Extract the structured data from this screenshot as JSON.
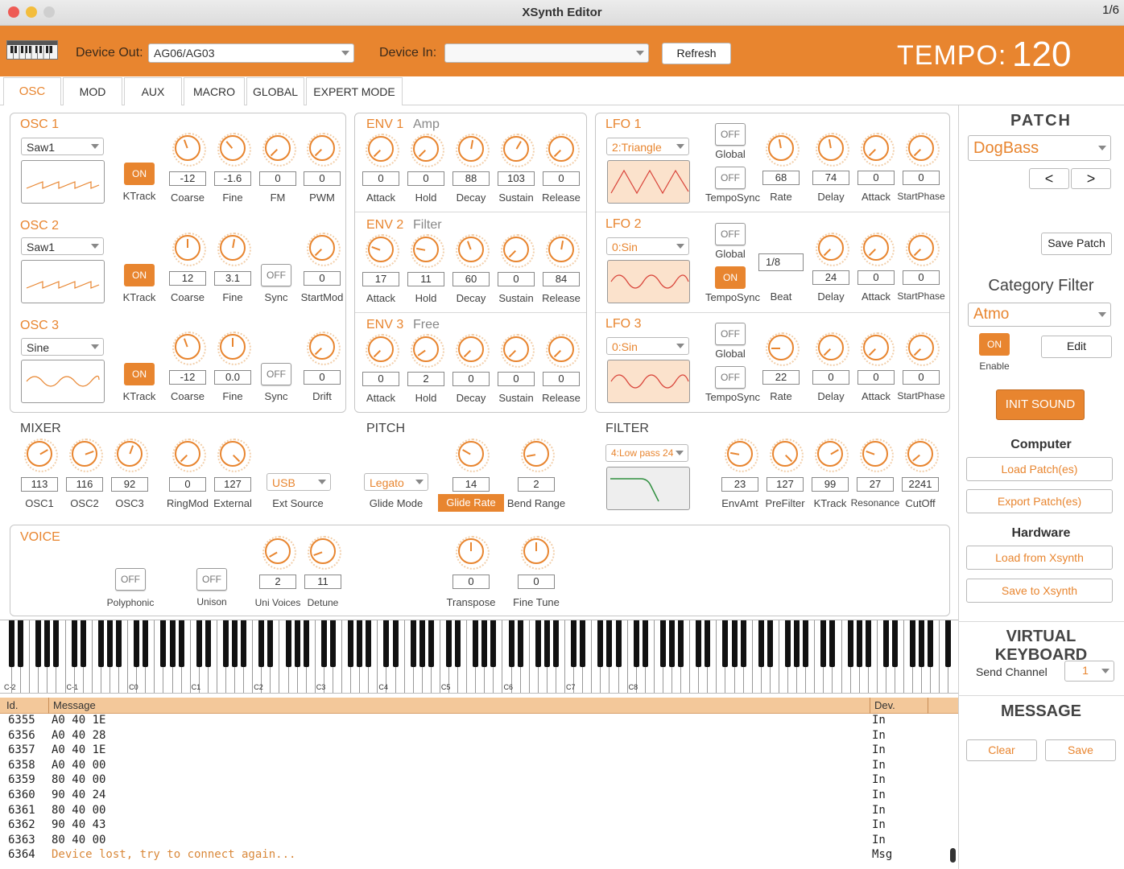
{
  "window": {
    "title": "XSynth Editor",
    "page_indicator": "1/6"
  },
  "topbar": {
    "device_out_label": "Device Out:",
    "device_out_value": "AG06/AG03",
    "device_in_label": "Device In:",
    "device_in_value": "",
    "refresh": "Refresh",
    "tempo_label": "TEMPO:",
    "tempo_value": "120",
    "color": "#e8852f"
  },
  "tabs": [
    "OSC",
    "MOD",
    "AUX",
    "MACRO",
    "GLOBAL",
    "EXPERT MODE"
  ],
  "osc": [
    {
      "title": "OSC 1",
      "wave": "Saw1",
      "ktrack": "ON",
      "ktrack_label": "KTrack",
      "params": [
        {
          "v": "-12",
          "l": "Coarse"
        },
        {
          "v": "-1.6",
          "l": "Fine"
        },
        {
          "v": "0",
          "l": "FM"
        },
        {
          "v": "0",
          "l": "PWM"
        }
      ]
    },
    {
      "title": "OSC 2",
      "wave": "Saw1",
      "ktrack": "ON",
      "ktrack_label": "KTrack",
      "sync": "OFF",
      "sync_label": "Sync",
      "params": [
        {
          "v": "12",
          "l": "Coarse"
        },
        {
          "v": "3.1",
          "l": "Fine"
        },
        {
          "v": "0",
          "l": "StartMod"
        }
      ]
    },
    {
      "title": "OSC 3",
      "wave": "Sine",
      "ktrack": "ON",
      "ktrack_label": "KTrack",
      "sync": "OFF",
      "sync_label": "Sync",
      "params": [
        {
          "v": "-12",
          "l": "Coarse"
        },
        {
          "v": "0.0",
          "l": "Fine"
        },
        {
          "v": "0",
          "l": "Drift"
        }
      ]
    }
  ],
  "env": [
    {
      "title": "ENV 1",
      "sub": "Amp",
      "values": [
        "0",
        "0",
        "88",
        "103",
        "0"
      ]
    },
    {
      "title": "ENV 2",
      "sub": "Filter",
      "values": [
        "17",
        "11",
        "60",
        "0",
        "84"
      ]
    },
    {
      "title": "ENV 3",
      "sub": "Free",
      "values": [
        "0",
        "2",
        "0",
        "0",
        "0"
      ]
    }
  ],
  "env_labels": [
    "Attack",
    "Hold",
    "Decay",
    "Sustain",
    "Release"
  ],
  "lfo": [
    {
      "title": "LFO 1",
      "wave": "2:Triangle",
      "global": "OFF",
      "global_label": "Global",
      "tsync": "OFF",
      "tsync_label": "TempoSync",
      "values": [
        "68",
        "74",
        "0",
        "0"
      ],
      "labels": [
        "Rate",
        "Delay",
        "Attack",
        "StartPhase"
      ]
    },
    {
      "title": "LFO 2",
      "wave": "0:Sin",
      "global": "OFF",
      "global_label": "Global",
      "tsync": "ON",
      "tsync_label": "TempoSync",
      "values": [
        "1/8",
        "24",
        "0",
        "0"
      ],
      "labels": [
        "Beat",
        "Delay",
        "Attack",
        "StartPhase"
      ]
    },
    {
      "title": "LFO 3",
      "wave": "0:Sin",
      "global": "OFF",
      "global_label": "Global",
      "tsync": "OFF",
      "tsync_label": "TempoSync",
      "values": [
        "22",
        "0",
        "0",
        "0"
      ],
      "labels": [
        "Rate",
        "Delay",
        "Attack",
        "StartPhase"
      ]
    }
  ],
  "mixer": {
    "title": "MIXER",
    "params": [
      {
        "v": "113",
        "l": "OSC1"
      },
      {
        "v": "116",
        "l": "OSC2"
      },
      {
        "v": "92",
        "l": "OSC3"
      },
      {
        "v": "0",
        "l": "RingMod"
      },
      {
        "v": "127",
        "l": "External"
      }
    ],
    "ext_source": "USB",
    "ext_source_label": "Ext Source"
  },
  "pitch": {
    "title": "PITCH",
    "glide_mode": "Legato",
    "glide_mode_label": "Glide Mode",
    "glide_rate": "14",
    "glide_rate_label": "Glide Rate",
    "bend_range": "2",
    "bend_range_label": "Bend Range"
  },
  "filter": {
    "title": "FILTER",
    "type": "4:Low pass 24",
    "params": [
      {
        "v": "23",
        "l": "EnvAmt"
      },
      {
        "v": "127",
        "l": "PreFilter"
      },
      {
        "v": "99",
        "l": "KTrack"
      },
      {
        "v": "27",
        "l": "Resonance"
      },
      {
        "v": "2241",
        "l": "CutOff"
      }
    ]
  },
  "voice": {
    "title": "VOICE",
    "polyphonic": "OFF",
    "polyphonic_label": "Polyphonic",
    "unison": "OFF",
    "unison_label": "Unison",
    "params": [
      {
        "v": "2",
        "l": "Uni Voices"
      },
      {
        "v": "11",
        "l": "Detune"
      },
      {
        "v": "0",
        "l": "Transpose"
      },
      {
        "v": "0",
        "l": "Fine Tune"
      }
    ]
  },
  "patch": {
    "title": "PATCH",
    "name": "DogBass",
    "prev": "<",
    "next": ">",
    "save": "Save Patch",
    "category_title": "Category Filter",
    "category": "Atmo",
    "enable": "ON",
    "enable_label": "Enable",
    "edit": "Edit",
    "init": "INIT  SOUND",
    "computer_title": "Computer",
    "load_patches": "Load Patch(es)",
    "export_patches": "Export Patch(es)",
    "hardware_title": "Hardware",
    "load_xsynth": "Load from Xsynth",
    "save_xsynth": "Save to Xsynth"
  },
  "keyboard": {
    "title": "VIRTUAL KEYBOARD",
    "send_channel_label": "Send Channel",
    "send_channel": "1",
    "octaves": [
      "C-2",
      "C-1",
      "C0",
      "C1",
      "C2",
      "C3",
      "C4",
      "C5",
      "C6",
      "C7",
      "C8"
    ]
  },
  "message": {
    "title": "MESSAGE",
    "clear": "Clear",
    "save": "Save",
    "col_id": "Id.",
    "col_message": "Message",
    "col_dev": "Dev.",
    "rows": [
      {
        "id": "6355",
        "msg": "A0 40 1E",
        "dev": "In"
      },
      {
        "id": "6356",
        "msg": "A0 40 28",
        "dev": "In"
      },
      {
        "id": "6357",
        "msg": "A0 40 1E",
        "dev": "In"
      },
      {
        "id": "6358",
        "msg": "A0 40 00",
        "dev": "In"
      },
      {
        "id": "6359",
        "msg": "80 40 00",
        "dev": "In"
      },
      {
        "id": "6360",
        "msg": "90 40 24",
        "dev": "In"
      },
      {
        "id": "6361",
        "msg": "80 40 00",
        "dev": "In"
      },
      {
        "id": "6362",
        "msg": "90 40 43",
        "dev": "In"
      },
      {
        "id": "6363",
        "msg": "80 40 00",
        "dev": "In"
      },
      {
        "id": "6364",
        "msg": "Device lost, try to connect again...",
        "dev": "Msg",
        "highlight": true
      }
    ]
  }
}
